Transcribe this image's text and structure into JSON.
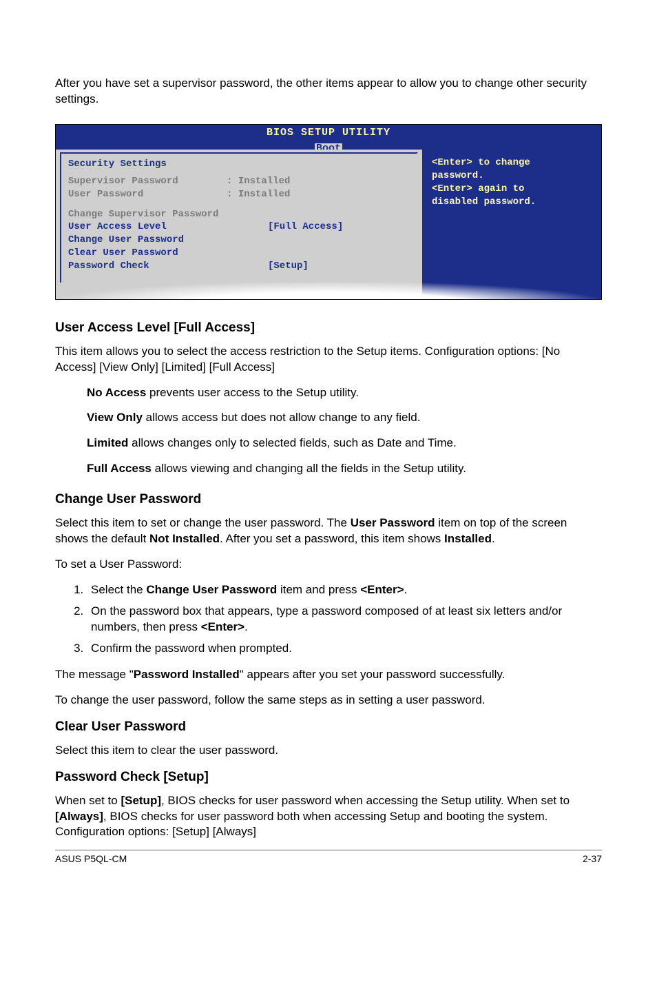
{
  "intro": "After you have set a supervisor password, the other items appear to allow you to change other security settings.",
  "bios": {
    "title": "BIOS SETUP UTILITY",
    "tab": "Boot",
    "left": {
      "heading": "Security Settings",
      "sup_label": "Supervisor Password",
      "sup_sep": ":",
      "sup_val": "Installed",
      "usr_label": "User Password",
      "usr_sep": ":",
      "usr_val": "Installed",
      "chg_sup": "Change Supervisor Password",
      "ual_label": "User Access Level",
      "ual_val": "[Full Access]",
      "chg_usr": "Change User Password",
      "clr_usr": "Clear User Password",
      "pwc_label": "Password Check",
      "pwc_val": "[Setup]"
    },
    "right": {
      "l1": "<Enter> to change",
      "l2": "password.",
      "l3": "<Enter> again to",
      "l4": "disabled password."
    }
  },
  "ual": {
    "heading": "User Access Level [Full Access]",
    "p1": "This item allows you to select the access restriction to the Setup items. Configuration options: [No Access] [View Only] [Limited] [Full Access]",
    "na_b": "No Access",
    "na_t": " prevents user access to the Setup utility.",
    "vo_b": "View Only",
    "vo_t": " allows access but does not allow change to any field.",
    "li_b": "Limited",
    "li_t": " allows changes only to selected fields, such as Date and Time.",
    "fa_b": "Full Access",
    "fa_t": " allows viewing and changing all the fields in the Setup utility."
  },
  "cup": {
    "heading": "Change User Password",
    "p1a": "Select this item to set or change the user password. The ",
    "p1b": "User Password",
    "p1c": " item on top of the screen shows the default ",
    "p1d": "Not Installed",
    "p1e": ". After you set a password, this item shows ",
    "p1f": "Installed",
    "p1g": ".",
    "p2": "To set a User Password:",
    "li1a": "Select the ",
    "li1b": "Change User Password",
    "li1c": " item and press ",
    "li1d": "<Enter>",
    "li1e": ".",
    "li2a": "On the password box that appears, type a password composed of at least six letters and/or numbers, then press ",
    "li2b": "<Enter>",
    "li2c": ".",
    "li3": "Confirm the password when prompted.",
    "p3a": "The message \"",
    "p3b": "Password Installed",
    "p3c": "\" appears after you set your password successfully.",
    "p4": "To change the user password, follow the same steps as in setting a user password."
  },
  "clrup": {
    "heading": "Clear User Password",
    "p": "Select this item to clear the user password."
  },
  "pwc": {
    "heading": "Password Check [Setup]",
    "p_a": "When set to ",
    "p_b": "[Setup]",
    "p_c": ", BIOS checks for user password when accessing the Setup utility. When set to ",
    "p_d": "[Always]",
    "p_e": ", BIOS checks for user password both when accessing Setup and booting the system. Configuration options: [Setup] [Always]"
  },
  "footer": {
    "left": "ASUS P5QL-CM",
    "right": "2-37"
  }
}
